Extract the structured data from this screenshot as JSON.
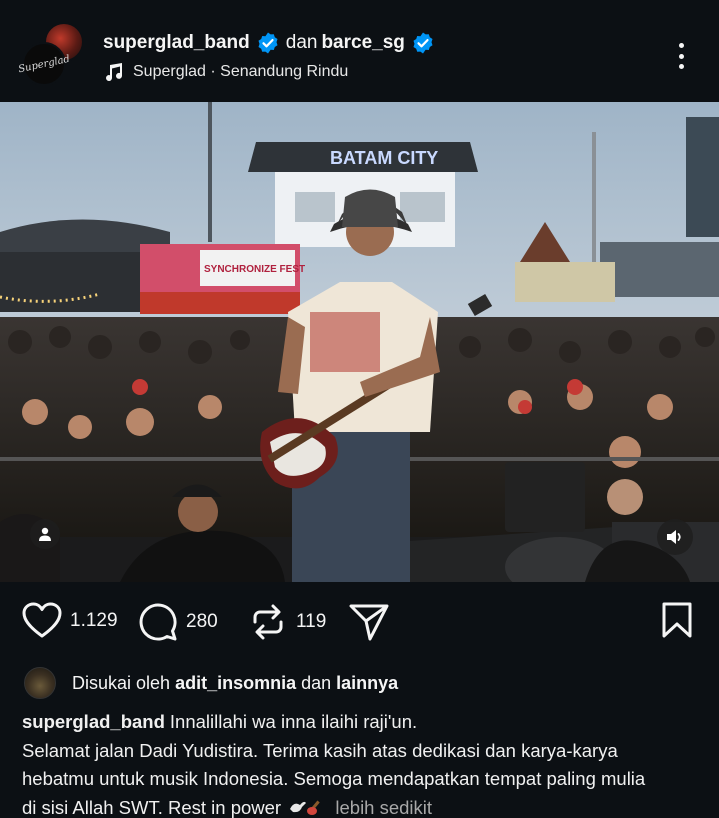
{
  "header": {
    "author1": "superglad_band",
    "conjunction": "dan",
    "author2": "barce_sg",
    "music": "Superglad · Senandung Rindu",
    "avatar_text": "Superglad",
    "icons": [
      "verified-badge-icon",
      "music-note-icon",
      "more-options-icon"
    ]
  },
  "photo": {
    "banner_text": "SYNCHRONIZE FEST",
    "tower_text": "BATAM CITY",
    "icons": [
      "user-tag-icon",
      "sound-icon"
    ]
  },
  "actions": {
    "likes_count": "1.129",
    "comments_count": "280",
    "reposts_count": "119",
    "icons": [
      "heart-icon",
      "comment-icon",
      "repost-icon",
      "share-icon",
      "bookmark-icon"
    ]
  },
  "likes": {
    "prefix": "Disukai oleh",
    "user": "adit_insomnia",
    "middle": "dan",
    "suffix": "lainnya"
  },
  "caption": {
    "username": "superglad_band",
    "line1": "Innalillahi wa inna ilaihi raji'un.",
    "line2": "Selamat jalan Dadi Yudistira. Terima kasih atas dedikasi dan karya-karya",
    "line3": "hebatmu untuk musik Indonesia. Semoga mendapatkan tempat paling mulia",
    "line4": "di sisi Allah SWT. Rest in power",
    "more_link": "lebih sedikit"
  },
  "colors": {
    "background": "#0c1014",
    "verified": "#0095f6",
    "muted_text": "#a8a8a8"
  }
}
